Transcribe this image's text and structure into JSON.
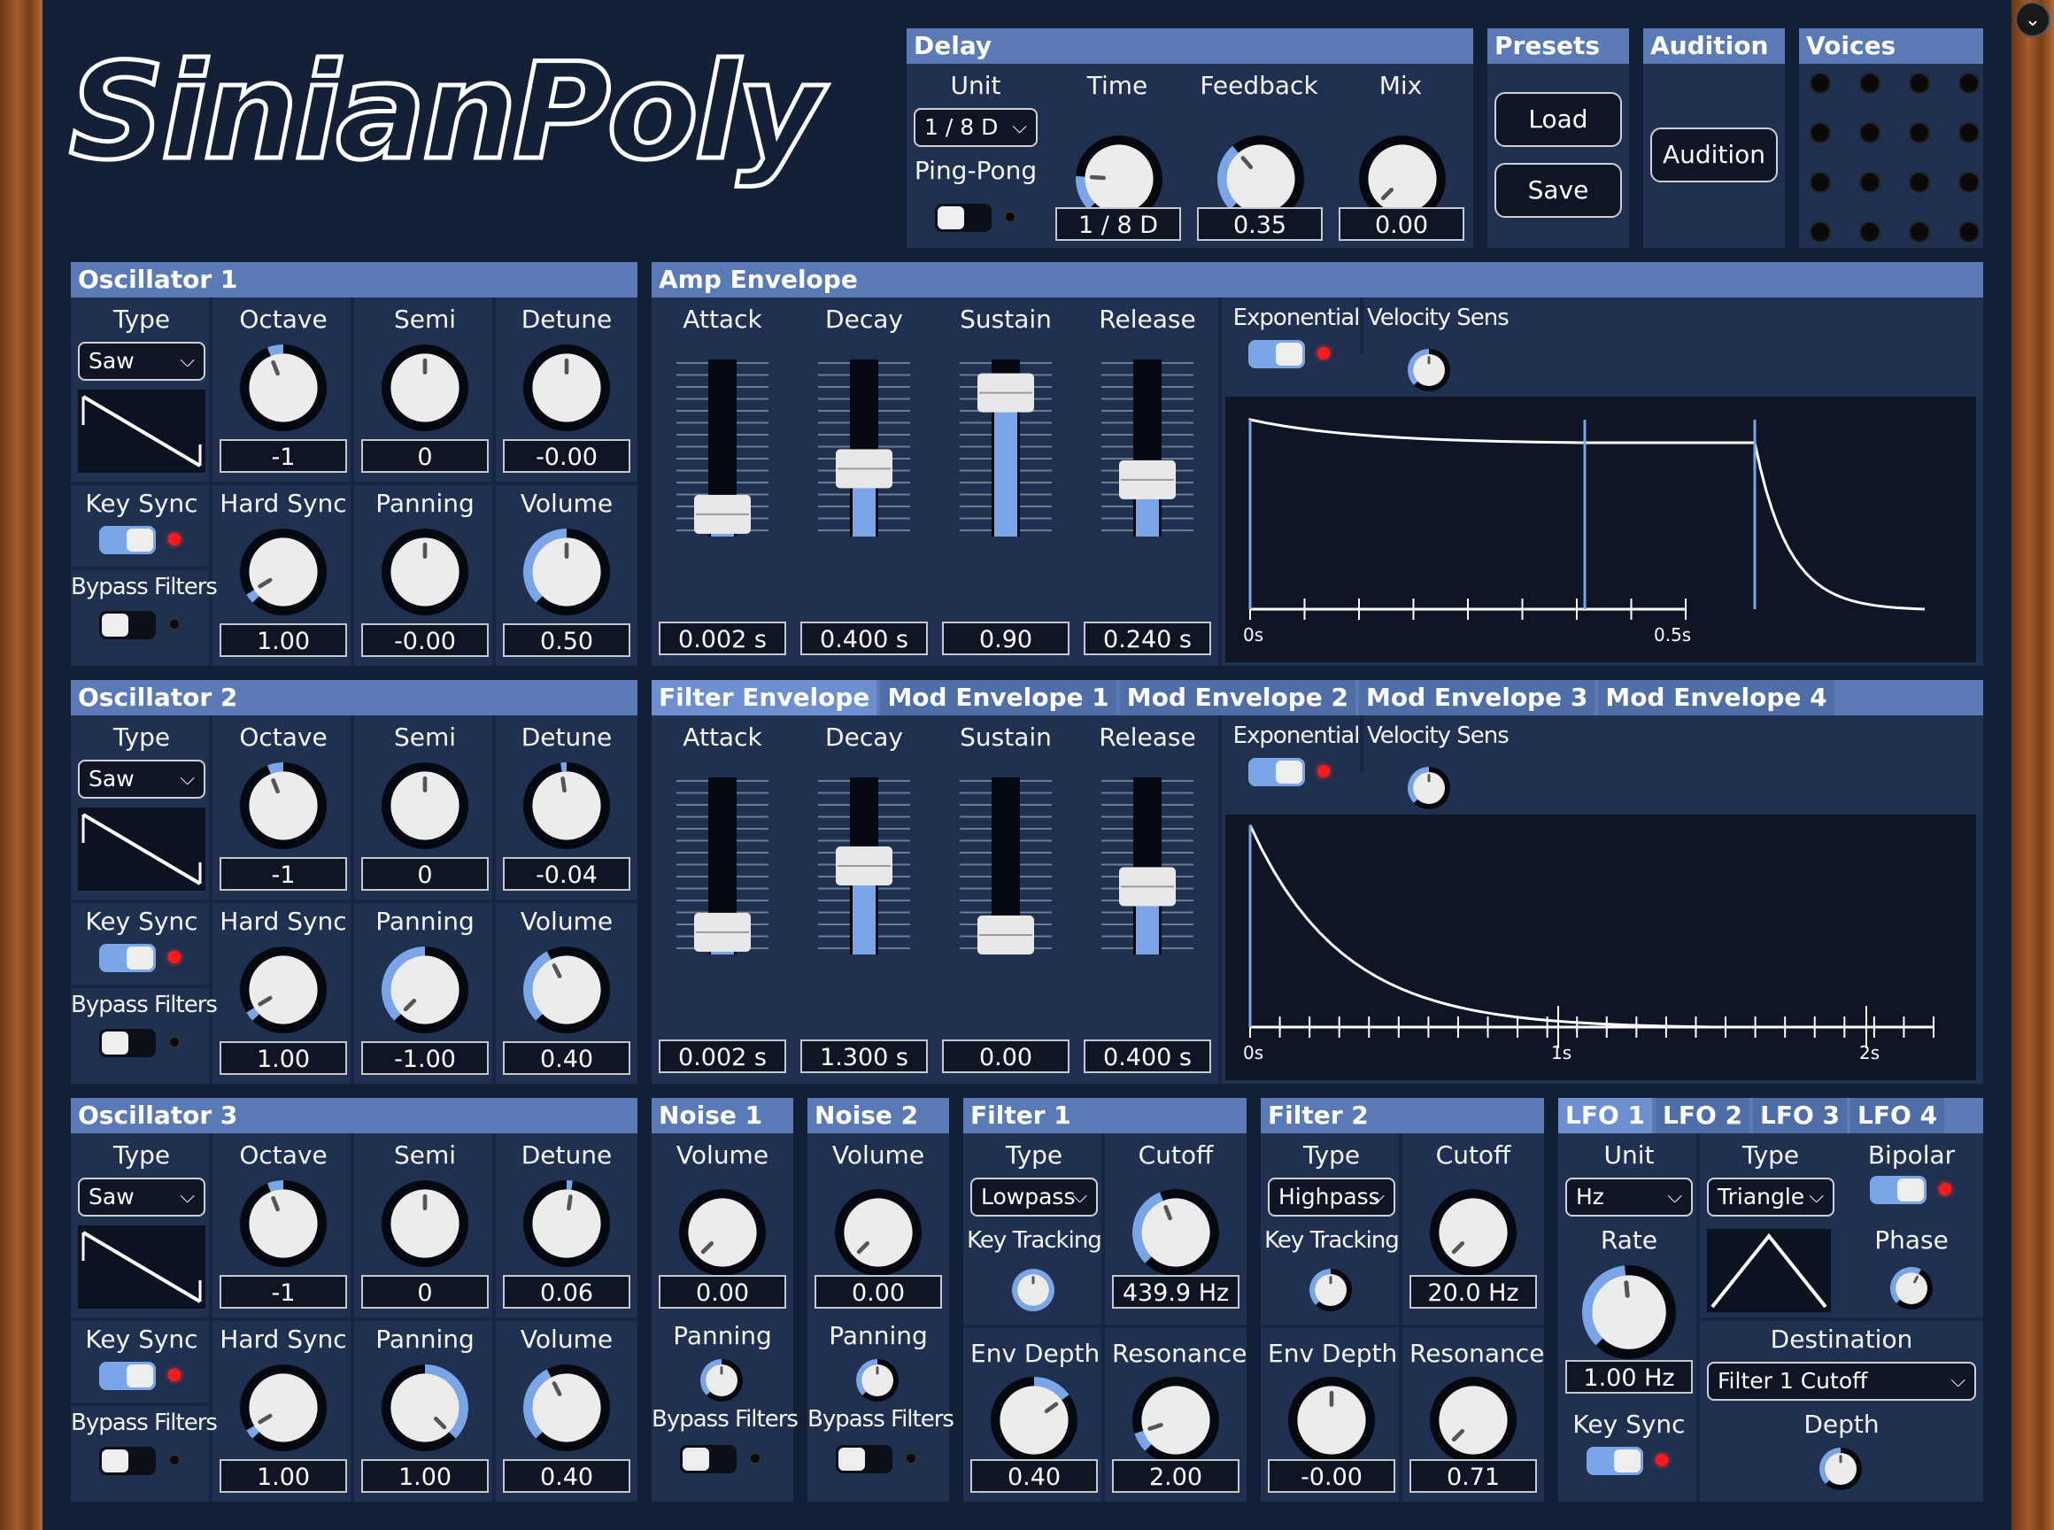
{
  "app": {
    "logo": "SinianPoly"
  },
  "delay": {
    "title": "Delay",
    "unit_label": "Unit",
    "unit_value": "1 / 8 D",
    "pingpong_label": "Ping-Pong",
    "time_label": "Time",
    "time_value": "1 / 8 D",
    "feedback_label": "Feedback",
    "feedback_value": "0.35",
    "mix_label": "Mix",
    "mix_value": "0.00"
  },
  "presets": {
    "title": "Presets",
    "load": "Load",
    "save": "Save"
  },
  "audition": {
    "title": "Audition",
    "button": "Audition"
  },
  "voices": {
    "title": "Voices"
  },
  "osc1": {
    "title": "Oscillator 1",
    "type_label": "Type",
    "type_value": "Saw",
    "octave_label": "Octave",
    "octave_value": "-1",
    "semi_label": "Semi",
    "semi_value": "0",
    "detune_label": "Detune",
    "detune_value": "-0.00",
    "keysync_label": "Key Sync",
    "hardsync_label": "Hard Sync",
    "hardsync_value": "1.00",
    "panning_label": "Panning",
    "panning_value": "-0.00",
    "volume_label": "Volume",
    "volume_value": "0.50",
    "bypass_label": "Bypass Filters"
  },
  "osc2": {
    "title": "Oscillator 2",
    "type_label": "Type",
    "type_value": "Saw",
    "octave_label": "Octave",
    "octave_value": "-1",
    "semi_label": "Semi",
    "semi_value": "0",
    "detune_label": "Detune",
    "detune_value": "-0.04",
    "keysync_label": "Key Sync",
    "hardsync_label": "Hard Sync",
    "hardsync_value": "1.00",
    "panning_label": "Panning",
    "panning_value": "-1.00",
    "volume_label": "Volume",
    "volume_value": "0.40",
    "bypass_label": "Bypass Filters"
  },
  "osc3": {
    "title": "Oscillator 3",
    "type_label": "Type",
    "type_value": "Saw",
    "octave_label": "Octave",
    "octave_value": "-1",
    "semi_label": "Semi",
    "semi_value": "0",
    "detune_label": "Detune",
    "detune_value": "0.06",
    "keysync_label": "Key Sync",
    "hardsync_label": "Hard Sync",
    "hardsync_value": "1.00",
    "panning_label": "Panning",
    "panning_value": "1.00",
    "volume_label": "Volume",
    "volume_value": "0.40",
    "bypass_label": "Bypass Filters"
  },
  "amp_env": {
    "title": "Amp Envelope",
    "attack_label": "Attack",
    "attack_value": "0.002 s",
    "decay_label": "Decay",
    "decay_value": "0.400 s",
    "sustain_label": "Sustain",
    "sustain_value": "0.90",
    "release_label": "Release",
    "release_value": "0.240 s",
    "exp_label": "Exponential",
    "vel_label": "Velocity Sens",
    "axis_0": "0s",
    "axis_1": "0.5s"
  },
  "env_tabs": [
    "Filter Envelope",
    "Mod Envelope 1",
    "Mod Envelope 2",
    "Mod Envelope 3",
    "Mod Envelope 4"
  ],
  "filter_env": {
    "attack_label": "Attack",
    "attack_value": "0.002 s",
    "decay_label": "Decay",
    "decay_value": "1.300 s",
    "sustain_label": "Sustain",
    "sustain_value": "0.00",
    "release_label": "Release",
    "release_value": "0.400 s",
    "exp_label": "Exponential",
    "vel_label": "Velocity Sens",
    "axis_0": "0s",
    "axis_1": "1s",
    "axis_2": "2s"
  },
  "noise1": {
    "title": "Noise 1",
    "volume_label": "Volume",
    "volume_value": "0.00",
    "panning_label": "Panning",
    "bypass_label": "Bypass Filters"
  },
  "noise2": {
    "title": "Noise 2",
    "volume_label": "Volume",
    "volume_value": "0.00",
    "panning_label": "Panning",
    "bypass_label": "Bypass Filters"
  },
  "filter1": {
    "title": "Filter 1",
    "type_label": "Type",
    "type_value": "Lowpass",
    "cutoff_label": "Cutoff",
    "cutoff_value": "439.9 Hz",
    "keytrack_label": "Key Tracking",
    "envdepth_label": "Env Depth",
    "envdepth_value": "0.40",
    "resonance_label": "Resonance",
    "resonance_value": "2.00"
  },
  "filter2": {
    "title": "Filter 2",
    "type_label": "Type",
    "type_value": "Highpass",
    "cutoff_label": "Cutoff",
    "cutoff_value": "20.0 Hz",
    "keytrack_label": "Key Tracking",
    "envdepth_label": "Env Depth",
    "envdepth_value": "-0.00",
    "resonance_label": "Resonance",
    "resonance_value": "0.71"
  },
  "lfo_tabs": [
    "LFO 1",
    "LFO 2",
    "LFO 3",
    "LFO 4"
  ],
  "lfo": {
    "unit_label": "Unit",
    "unit_value": "Hz",
    "type_label": "Type",
    "type_value": "Triangle",
    "bipolar_label": "Bipolar",
    "rate_label": "Rate",
    "rate_value": "1.00 Hz",
    "phase_label": "Phase",
    "destination_label": "Destination",
    "destination_value": "Filter 1 Cutoff",
    "keysync_label": "Key Sync",
    "depth_label": "Depth"
  },
  "colors": {
    "background": "#142035",
    "panel": "#1f3050",
    "header": "#5a7ab5",
    "accent": "#7aa6e8",
    "led": "#ff1a1a"
  }
}
